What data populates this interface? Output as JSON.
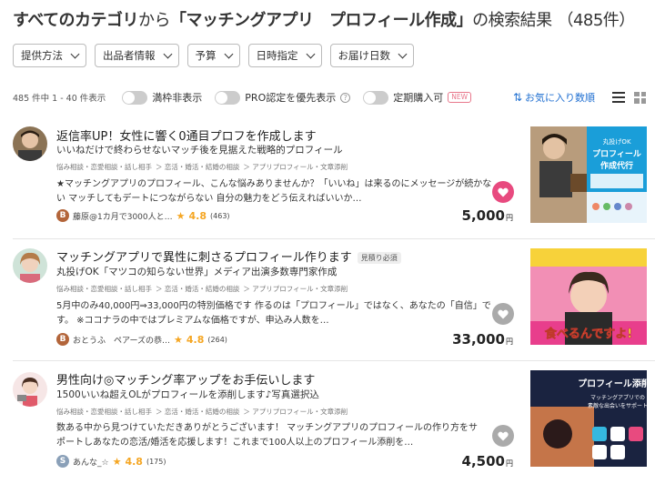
{
  "heading": {
    "bold_part": "すべてのカテゴリ",
    "mid_part": "から",
    "query": "「マッチングアプリ　プロフィール作成」",
    "tail": "の検索結果",
    "count": "（485件）"
  },
  "filters": [
    "提供方法",
    "出品者情報",
    "予算",
    "日時指定",
    "お届け日数"
  ],
  "toolbar": {
    "count": "485 件中 1 - 40 件表示",
    "toggle_full": "満枠非表示",
    "toggle_pro": "PRO認定を優先表示",
    "help": "?",
    "toggle_subscription": "定期購入可",
    "new_badge": "NEW",
    "sort": "お気に入り数順",
    "sort_icon": "sort-arrows-icon"
  },
  "colors": {
    "accent": "#1f6fd1",
    "heart_on": "#e84a7f",
    "star": "#f5a623",
    "rank_b": "#b3653a",
    "rank_s": "#8aa0b8"
  },
  "listings": [
    {
      "title": "返信率UP！女性に響く0通目プロフを作成します",
      "subtitle": "いいねだけで終わらせないマッチ後を見据えた戦略的プロフィール",
      "categories": [
        "悩み相談・恋愛相談・話し相手",
        "＞ 恋活・婚活・結婚の相談",
        "＞ アプリプロフィール・文章添削"
      ],
      "desc": "★マッチングアプリのプロフィール、こんな悩みありませんか？「いいね」は来るのにメッセージが続かない マッチしてもデートにつながらない 自分の魅力をどう伝えればいいか…",
      "rank": "B",
      "seller": "藤原@1カ月で3000人と…",
      "rating": "4.8",
      "reviews": "(463)",
      "price": "5,000",
      "yen": "円",
      "favorited": true,
      "thumb_texts": [
        "丸投げOK",
        "プロフィール",
        "作成代行"
      ],
      "quote_badge": ""
    },
    {
      "title": "マッチングアプリで異性に刺さるプロフィール作ります",
      "subtitle": "丸投げOK「マツコの知らない世界」メディア出演多数専門家作成",
      "categories": [
        "悩み相談・恋愛相談・話し相手",
        "＞ 恋活・婚活・結婚の相談",
        "＞ アプリプロフィール・文章添削"
      ],
      "desc": "5月中のみ40,000円⇒33,000円の特別価格です 作るのは「プロフィール」ではなく、あなたの「自信」です。 ※ココナラの中ではプレミアムな価格ですが、申込み人数を…",
      "rank": "B",
      "seller": "おとうふ　ペアーズの恭…",
      "rating": "4.8",
      "reviews": "(264)",
      "price": "33,000",
      "yen": "円",
      "favorited": false,
      "thumb_texts": [
        "食べるんですよ!"
      ],
      "quote_badge": "見積り必須"
    },
    {
      "title": "男性向け◎マッチング率アップをお手伝いします",
      "subtitle": "1500いいね超えOLがプロフィールを添削します♪写真選択込",
      "categories": [
        "悩み相談・恋愛相談・話し相手",
        "＞ 恋活・婚活・結婚の相談",
        "＞ アプリプロフィール・文章添削"
      ],
      "desc": "数ある中から見つけていただきありがとうございます！ マッチングアプリのプロフィールの作り方をサポートしあなたの恋活/婚活を応援します！これまで100人以上のプロフィール添削を…",
      "rank": "S",
      "seller": "あんな_☆",
      "rating": "4.8",
      "reviews": "(175)",
      "price": "4,500",
      "yen": "円",
      "favorited": false,
      "thumb_texts": [
        "プロフィール添削",
        "マッチングアプリでの",
        "素敵な出会いをサポート"
      ],
      "quote_badge": ""
    }
  ]
}
